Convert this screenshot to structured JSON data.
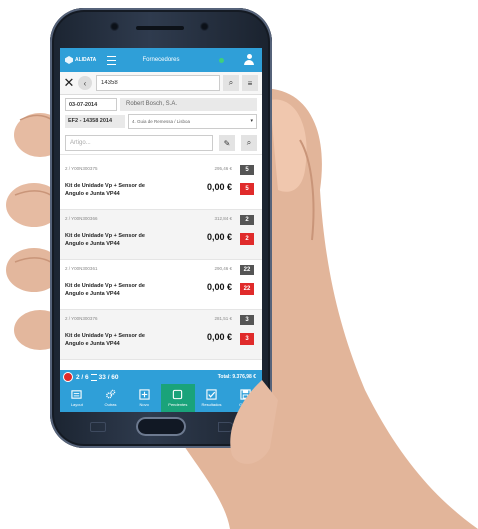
{
  "app": {
    "logo_text": "ALIDATA",
    "title": "Fornecedores"
  },
  "search": {
    "value": "14358"
  },
  "header": {
    "date": "03-07-2014",
    "supplier": "Robert Bosch, S.A.",
    "document": "EF2 - 14358 2014",
    "series": "4. Guia de Remessa / Lisboa"
  },
  "article": {
    "placeholder": "Artigo..."
  },
  "items": [
    {
      "ref": "2 / Y00N300375",
      "price": "295,46 €",
      "qty": "5",
      "name": "Kit de Unidade Vp + Sensor de Angulo e Junta VP44",
      "total": "0,00 €",
      "badge": "5"
    },
    {
      "ref": "2 / Y00N300366",
      "price": "312,84 €",
      "qty": "2",
      "name": "Kit de Unidade Vp + Sensor de Angulo e Junta VP44",
      "total": "0,00 €",
      "badge": "2"
    },
    {
      "ref": "2 / Y00N300361",
      "price": "290,46 €",
      "qty": "22",
      "name": "Kit de Unidade Vp + Sensor de Angulo e Junta VP44",
      "total": "0,00 €",
      "badge": "22"
    },
    {
      "ref": "2 / Y00N300376",
      "price": "281,51 €",
      "qty": "3",
      "name": "Kit de Unidade Vp + Sensor de Angulo e Junta VP44",
      "total": "0,00 €",
      "badge": "3"
    }
  ],
  "status": {
    "page": "2 / 6",
    "count": "33 / 60",
    "total": "Total: 9.376,98 €"
  },
  "tabs": [
    {
      "label": "Layout",
      "icon": "list-icon"
    },
    {
      "label": "Outras",
      "icon": "gears-icon"
    },
    {
      "label": "Novo",
      "icon": "plus-icon"
    },
    {
      "label": "Pendentes",
      "icon": "square-icon"
    },
    {
      "label": "Resultados",
      "icon": "check-icon"
    },
    {
      "label": "Gravar",
      "icon": "save-icon"
    }
  ],
  "colors": {
    "accent": "#2f9fd8",
    "active_tab": "#1aa37a",
    "badge_red": "#e02b2b"
  }
}
